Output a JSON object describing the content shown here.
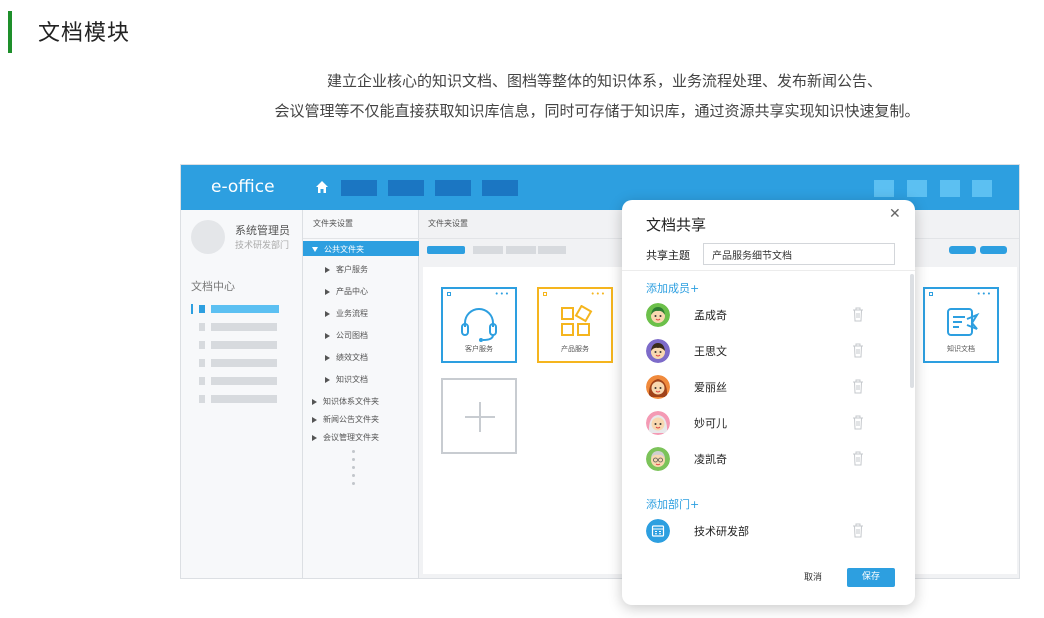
{
  "section": {
    "title": "文档模块",
    "description_line1": "建立企业核心的知识文档、图档等整体的知识体系，业务流程处理、发布新闻公告、",
    "description_line2": "会议管理等不仅能直接获取知识库信息，同时可存储于知识库，通过资源共享实现知识快速复制。"
  },
  "app": {
    "logo": "e-office",
    "user": {
      "name": "系统管理员",
      "dept": "技术研发部门"
    },
    "left_nav_title": "文档中心",
    "tree": {
      "header": "文件夹设置",
      "selected": "公共文件夹",
      "children": [
        "客户服务",
        "产品中心",
        "业务流程",
        "公司图档",
        "绩效文档",
        "知识文档"
      ],
      "roots": [
        "知识体系文件夹",
        "新闻公告文件夹",
        "会议管理文件夹"
      ]
    },
    "main_header": "文件夹设置",
    "cards": [
      {
        "label": "客户服务",
        "color": "#2d9fe0",
        "icon": "headset-icon"
      },
      {
        "label": "产品服务",
        "color": "#f5b51e",
        "icon": "product-blocks-icon"
      },
      {
        "label": "知识文档",
        "color": "#2d9fe0",
        "icon": "knowledge-doc-icon"
      }
    ],
    "accent_color": "#2d9fe0"
  },
  "modal": {
    "title": "文档共享",
    "theme_label": "共享主题",
    "theme_value": "产品服务细节文档",
    "add_member": "添加成员+",
    "members": [
      {
        "name": "孟成奇",
        "avatar": "avatar-green-icon"
      },
      {
        "name": "王思文",
        "avatar": "avatar-purple-icon"
      },
      {
        "name": "爱丽丝",
        "avatar": "avatar-orange-icon"
      },
      {
        "name": "妙可儿",
        "avatar": "avatar-pink-icon"
      },
      {
        "name": "凌凯奇",
        "avatar": "avatar-green-glasses-icon"
      }
    ],
    "add_dept": "添加部门+",
    "departments": [
      {
        "name": "技术研发部",
        "avatar": "department-icon"
      }
    ],
    "cancel": "取消",
    "save": "保存"
  }
}
